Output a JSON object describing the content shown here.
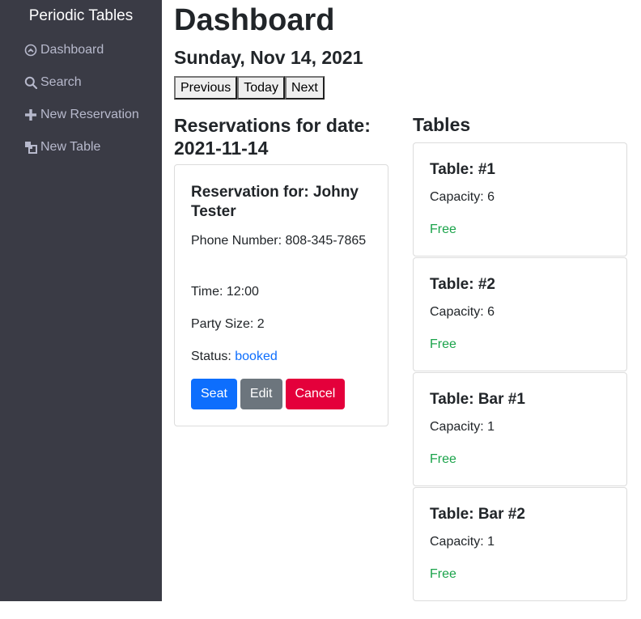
{
  "sidebar": {
    "brand": "Periodic Tables",
    "items": [
      {
        "label": "Dashboard",
        "icon": "dashboard-icon"
      },
      {
        "label": "Search",
        "icon": "search-icon"
      },
      {
        "label": "New Reservation",
        "icon": "plus-icon"
      },
      {
        "label": "New Table",
        "icon": "new-table-icon"
      }
    ]
  },
  "header": {
    "title": "Dashboard",
    "date": "Sunday, Nov 14, 2021",
    "nav": {
      "previous": "Previous",
      "today": "Today",
      "next": "Next"
    }
  },
  "reservations": {
    "heading": "Reservations for date: 2021-11-14",
    "items": [
      {
        "name": "Reservation for: Johny Tester",
        "phone": "Phone Number: 808-345-7865",
        "time": "Time: 12:00",
        "party": "Party Size: 2",
        "status_label": "Status: ",
        "status_value": "booked",
        "actions": {
          "seat": "Seat",
          "edit": "Edit",
          "cancel": "Cancel"
        }
      }
    ]
  },
  "tables": {
    "heading": "Tables",
    "items": [
      {
        "name": "Table: #1",
        "capacity": "Capacity: 6",
        "status": "Free"
      },
      {
        "name": "Table: #2",
        "capacity": "Capacity: 6",
        "status": "Free"
      },
      {
        "name": "Table: Bar #1",
        "capacity": "Capacity: 1",
        "status": "Free"
      },
      {
        "name": "Table: Bar #2",
        "capacity": "Capacity: 1",
        "status": "Free"
      }
    ]
  },
  "colors": {
    "sidebar_bg": "#3a3b45",
    "primary": "#0d6efd",
    "secondary": "#6c757d",
    "danger": "#e4003b",
    "free": "#1aa34a",
    "booked": "#0d6efd"
  }
}
